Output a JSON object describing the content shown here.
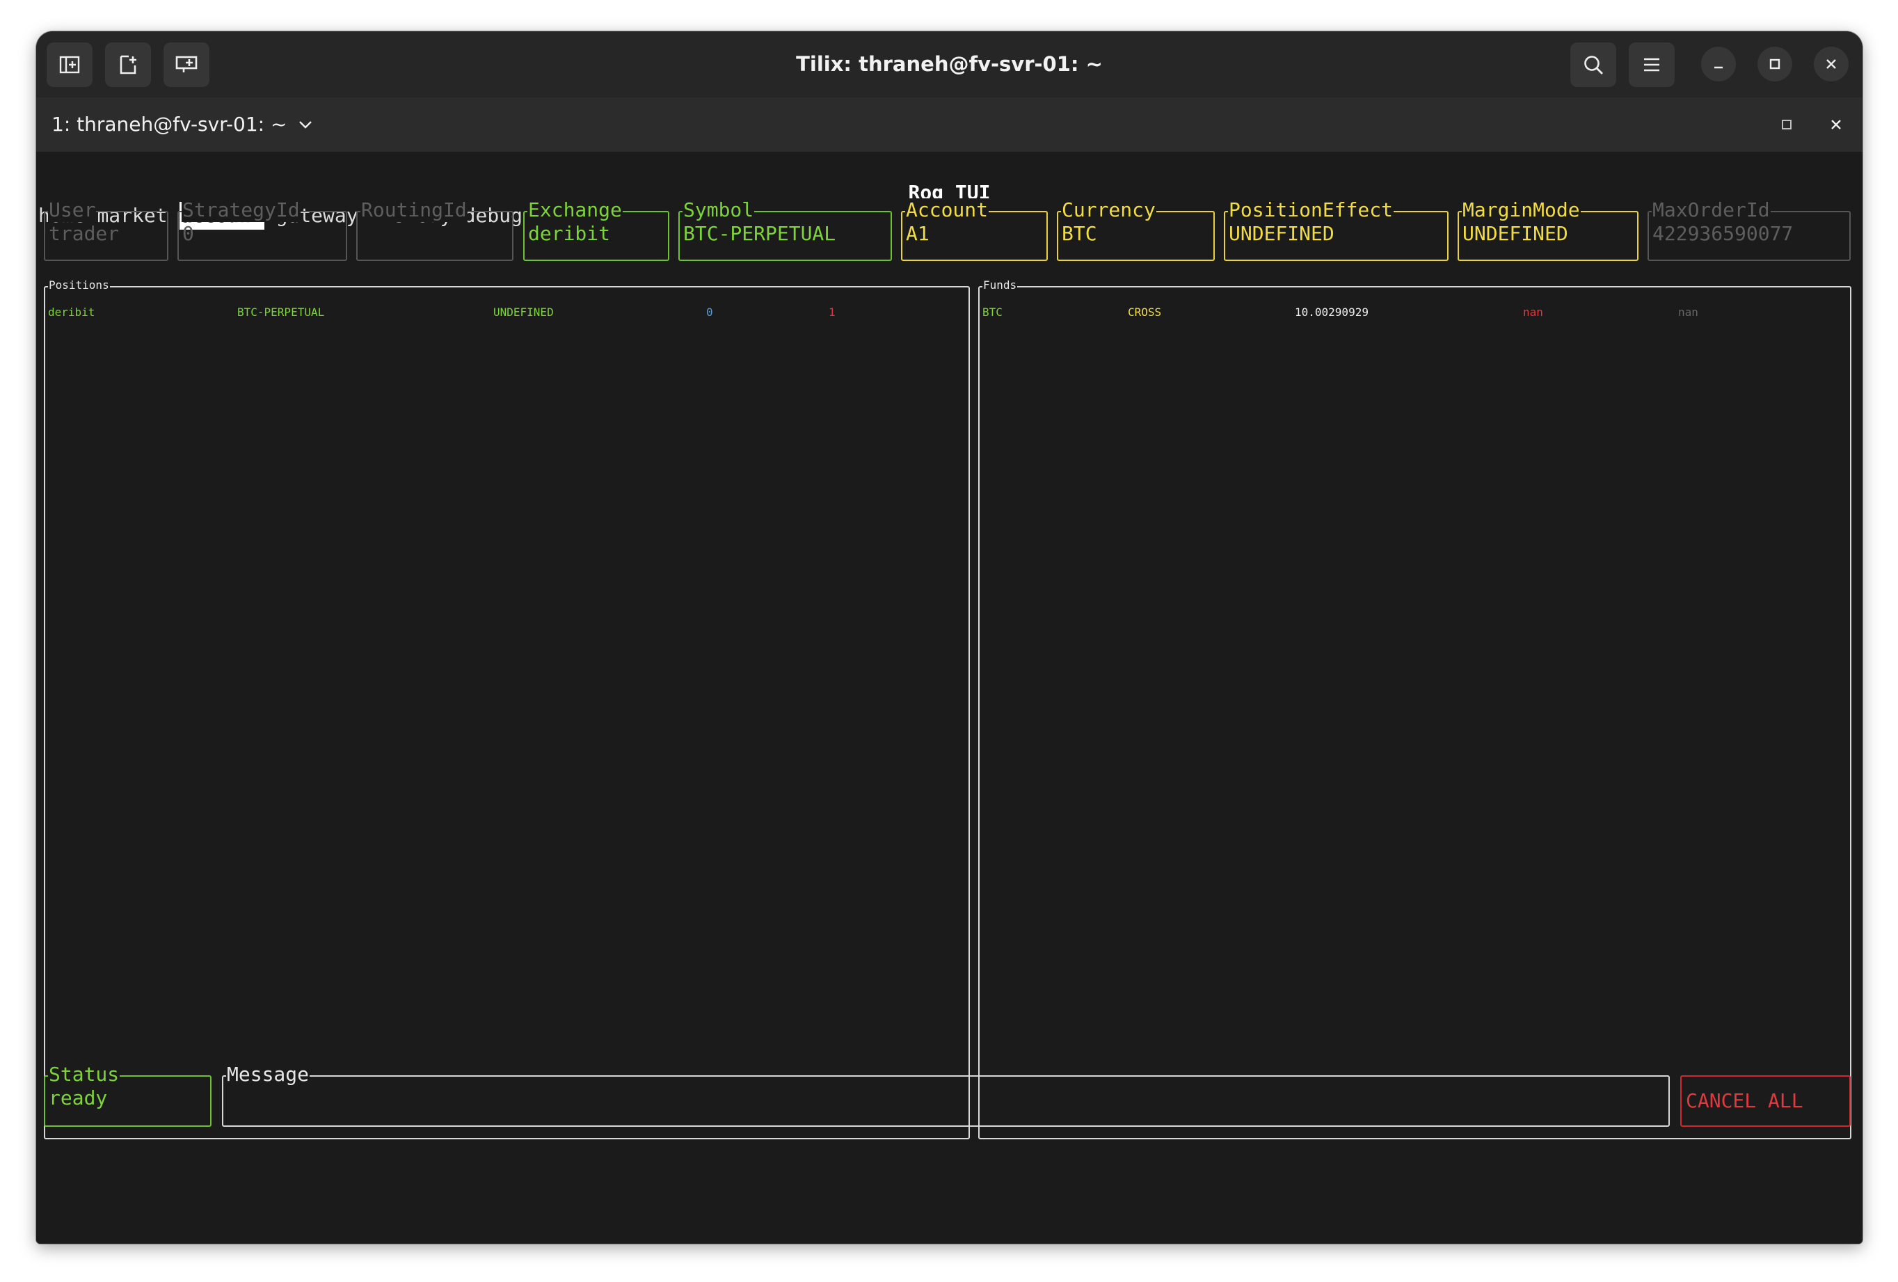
{
  "window": {
    "title": "Tilix: thraneh@fv-svr-01: ~",
    "tab_label": "1: thraneh@fv-svr-01: ~"
  },
  "app": {
    "title": "Roq TUI",
    "menu": [
      "home",
      "market",
      "account",
      "gateway",
      "history",
      "debug"
    ],
    "active_menu": "account"
  },
  "fields": [
    {
      "label": "User",
      "value": "trader",
      "state": "disabled"
    },
    {
      "label": "StrategyId",
      "value": "0",
      "state": "disabled"
    },
    {
      "label": "RoutingId",
      "value": "",
      "state": "disabled"
    },
    {
      "label": "Exchange",
      "value": "deribit",
      "state": "green"
    },
    {
      "label": "Symbol",
      "value": "BTC-PERPETUAL",
      "state": "green"
    },
    {
      "label": "Account",
      "value": "A1",
      "state": "yellow"
    },
    {
      "label": "Currency",
      "value": "BTC",
      "state": "yellow"
    },
    {
      "label": "PositionEffect",
      "value": "UNDEFINED",
      "state": "yellow"
    },
    {
      "label": "MarginMode",
      "value": "UNDEFINED",
      "state": "yellow"
    },
    {
      "label": "MaxOrderId",
      "value": "422936590077",
      "state": "disabled"
    }
  ],
  "positions": {
    "title": "Positions",
    "rows": [
      {
        "exchange": "deribit",
        "symbol": "BTC-PERPETUAL",
        "effect": "UNDEFINED",
        "long": "0",
        "short": "1"
      }
    ]
  },
  "funds": {
    "title": "Funds",
    "rows": [
      {
        "currency": "BTC",
        "mode": "CROSS",
        "balance": "10.00290929",
        "hold": "nan",
        "external": "nan"
      }
    ]
  },
  "footer": {
    "status_label": "Status",
    "status_value": "ready",
    "message_label": "Message",
    "message_value": "",
    "cancel_label": "CANCEL ALL"
  },
  "colors": {
    "background": "#1b1b1b",
    "green": "#7dd33a",
    "yellow": "#f2dc44",
    "red": "#e0393e",
    "blue": "#5b9bd5"
  }
}
